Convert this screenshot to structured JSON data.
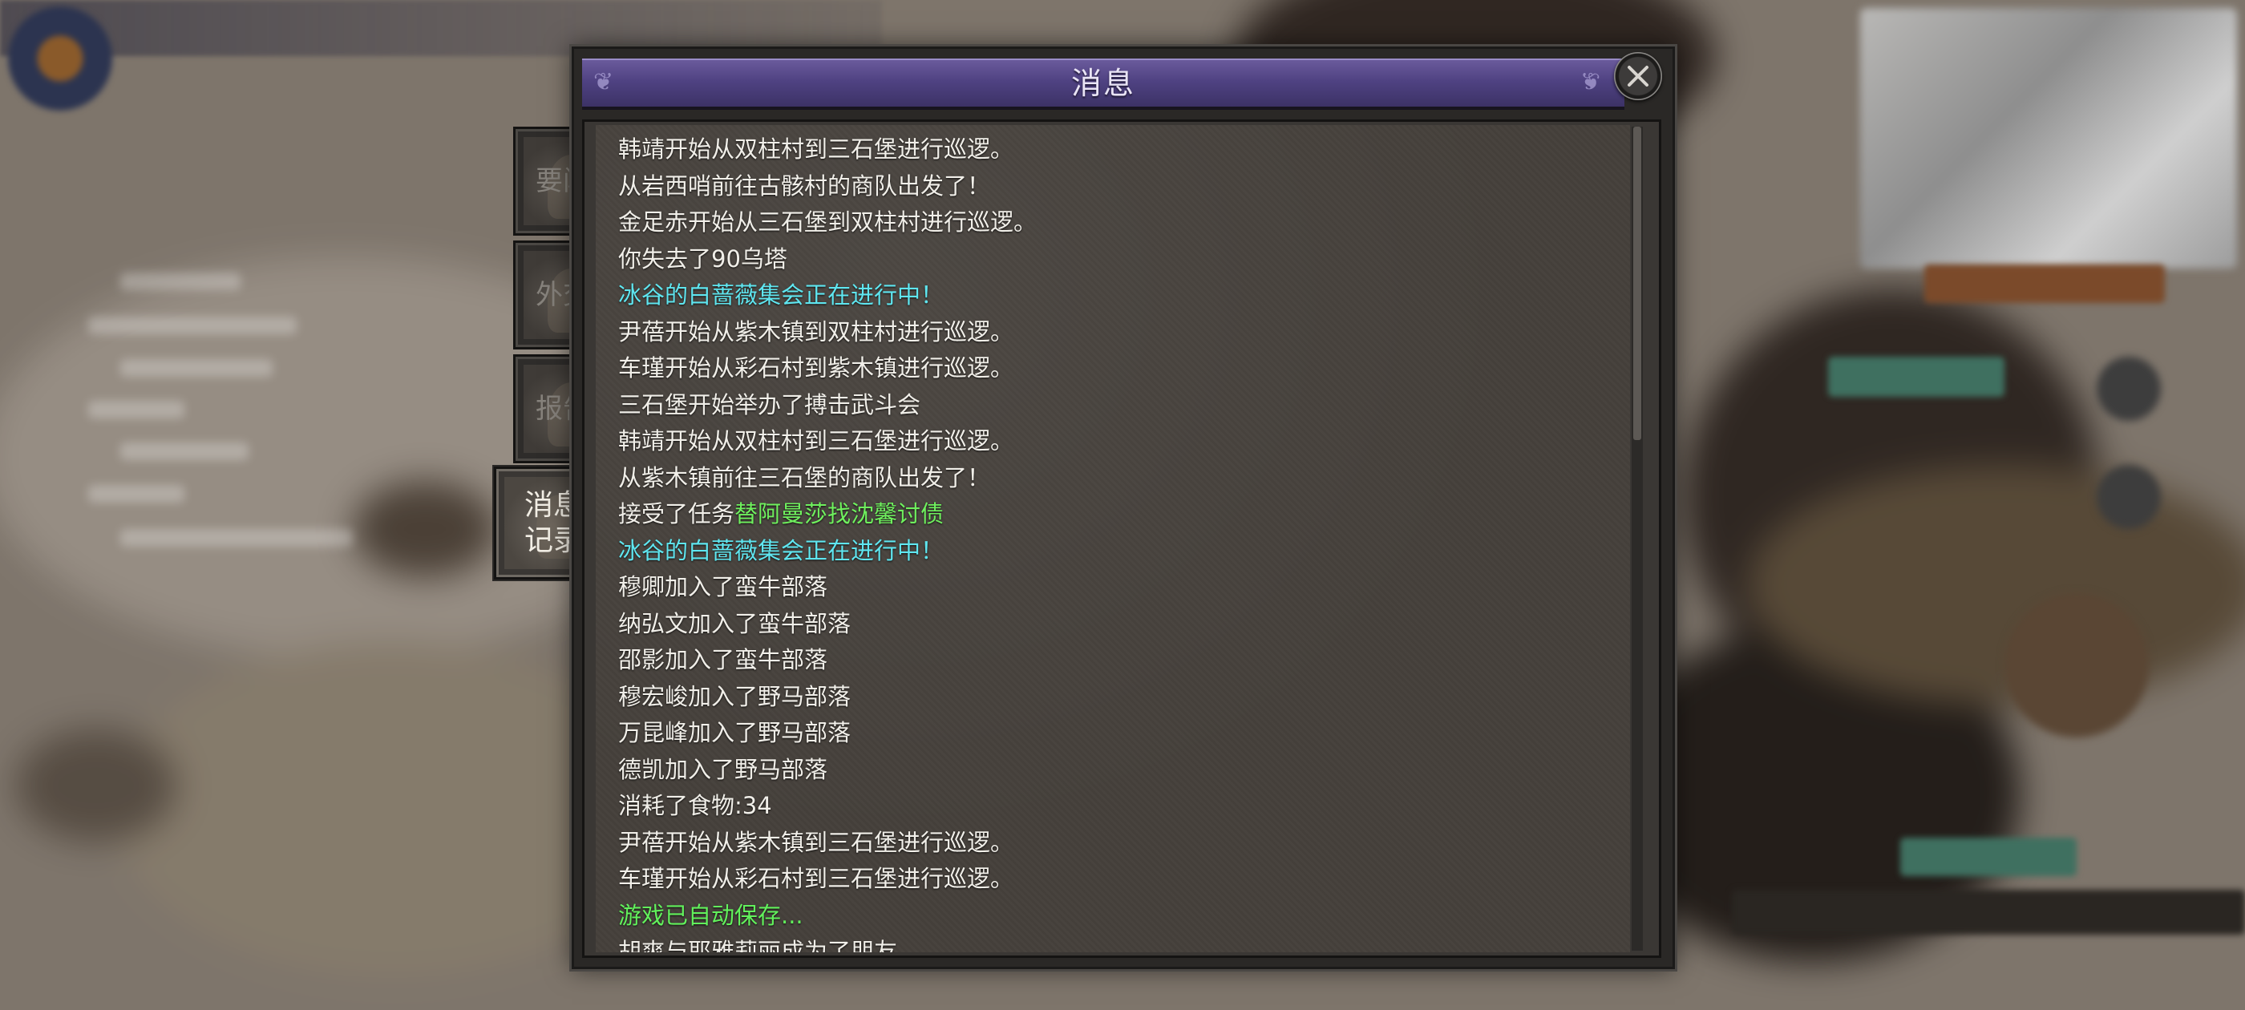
{
  "window": {
    "title": "消息"
  },
  "tabs": [
    {
      "label": "要闻",
      "active": false
    },
    {
      "label": "外交",
      "active": false
    },
    {
      "label": "报告",
      "active": false
    },
    {
      "label": "消息\n记录",
      "active": true
    }
  ],
  "messages": [
    {
      "text": "韩靖开始从双柱村到三石堡进行巡逻。",
      "color": "white"
    },
    {
      "text": "从岩西哨前往古骸村的商队出发了！",
      "color": "white"
    },
    {
      "text": "金足赤开始从三石堡到双柱村进行巡逻。",
      "color": "white"
    },
    {
      "text": "你失去了90乌塔",
      "color": "white"
    },
    {
      "text": "冰谷的白蔷薇集会正在进行中！",
      "color": "cyan"
    },
    {
      "text": "尹蓓开始从紫木镇到双柱村进行巡逻。",
      "color": "white"
    },
    {
      "text": "车瑾开始从彩石村到紫木镇进行巡逻。",
      "color": "white"
    },
    {
      "text": "三石堡开始举办了搏击武斗会",
      "color": "white"
    },
    {
      "text": "韩靖开始从双柱村到三石堡进行巡逻。",
      "color": "white"
    },
    {
      "text": "从紫木镇前往三石堡的商队出发了！",
      "color": "white"
    },
    {
      "text": "接受了任务",
      "highlight": "替阿曼莎找沈馨讨债",
      "color": "white"
    },
    {
      "text": "冰谷的白蔷薇集会正在进行中！",
      "color": "cyan"
    },
    {
      "text": "穆卿加入了蛮牛部落",
      "color": "white"
    },
    {
      "text": "纳弘文加入了蛮牛部落",
      "color": "white"
    },
    {
      "text": "邵影加入了蛮牛部落",
      "color": "white"
    },
    {
      "text": "穆宏峻加入了野马部落",
      "color": "white"
    },
    {
      "text": "万昆峰加入了野马部落",
      "color": "white"
    },
    {
      "text": "德凯加入了野马部落",
      "color": "white"
    },
    {
      "text": "消耗了食物:34",
      "color": "white"
    },
    {
      "text": "尹蓓开始从紫木镇到三石堡进行巡逻。",
      "color": "white"
    },
    {
      "text": "车瑾开始从彩石村到三石堡进行巡逻。",
      "color": "white"
    },
    {
      "text": "游戏已自动保存...",
      "color": "green"
    },
    {
      "text": "胡爽与耶雅莉丽成为了朋友",
      "color": "white"
    }
  ],
  "icons": {
    "close": "close-icon",
    "title_ornament": "vine-ornament-icon"
  },
  "colors": {
    "title_bar": "#4f4282",
    "text": "#f1efe9",
    "event_cyan": "#5fe6f0",
    "quest_green": "#6ff05e",
    "system_green": "#62f15c"
  },
  "scroll": {
    "position_fraction": 0.0,
    "visible_fraction": 0.38
  }
}
